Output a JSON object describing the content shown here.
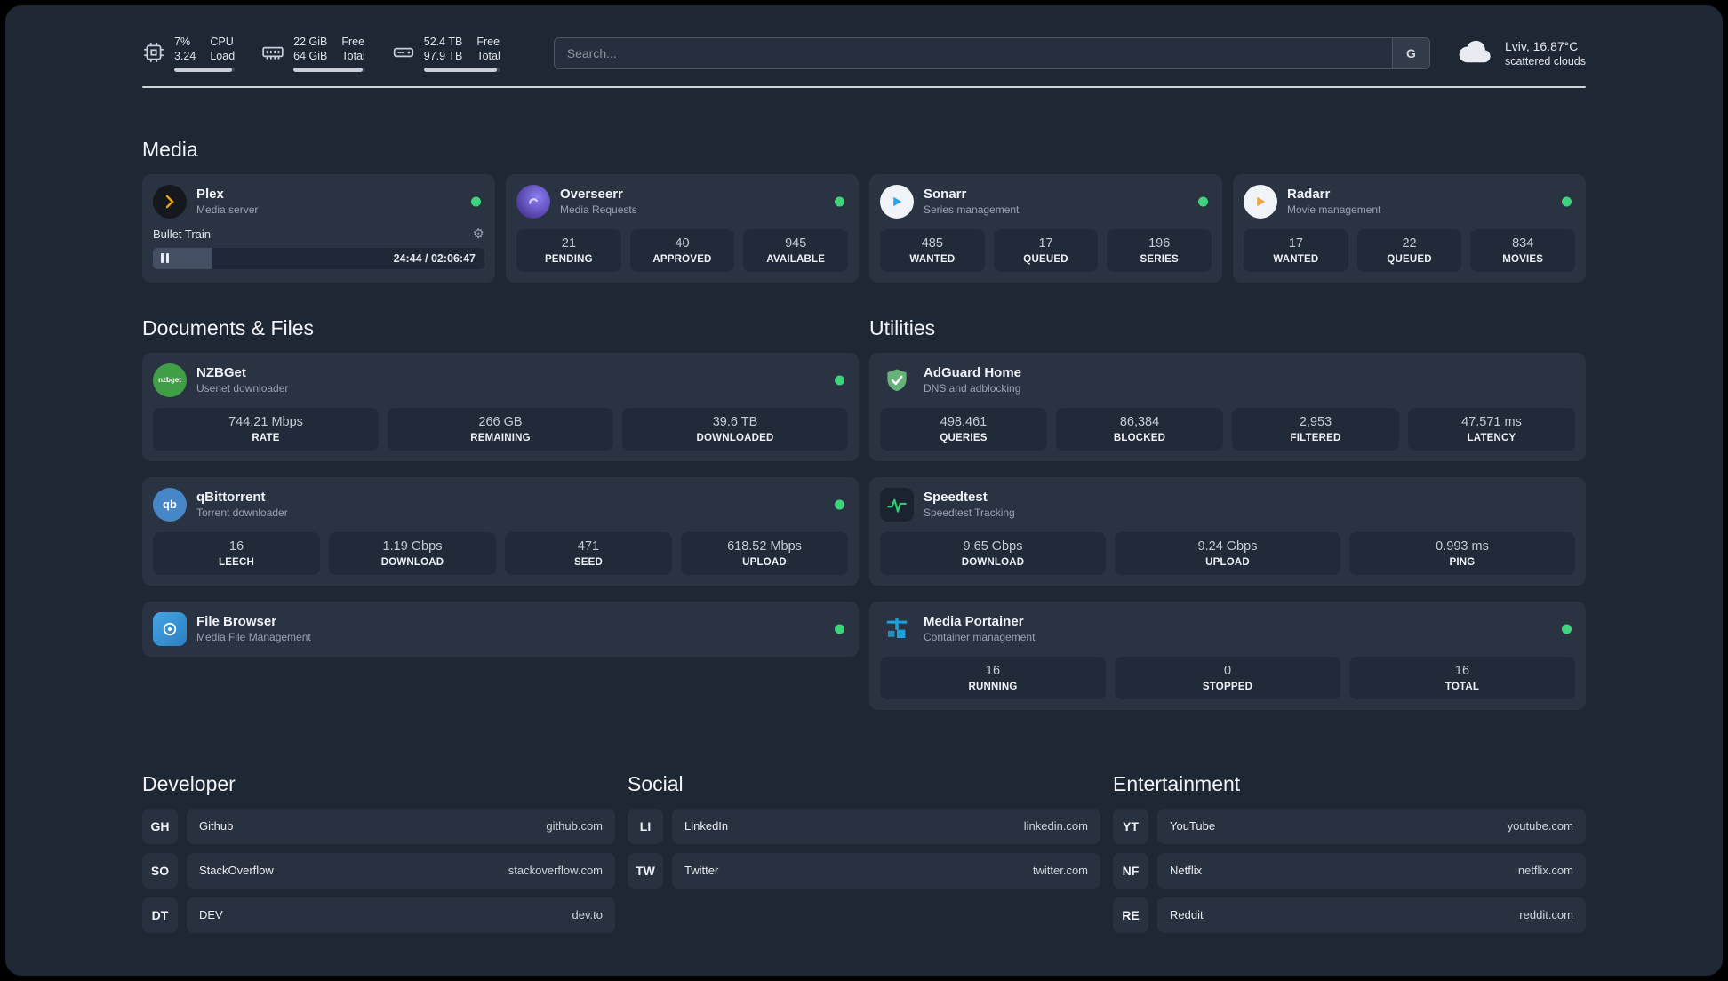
{
  "topbar": {
    "cpu": {
      "percent": "7%",
      "load": "3.24",
      "label_top": "CPU",
      "label_bottom": "Load"
    },
    "ram": {
      "free": "22 GiB",
      "total": "64 GiB",
      "label_top": "Free",
      "label_bottom": "Total"
    },
    "disk": {
      "free": "52.4 TB",
      "total": "97.9 TB",
      "label_top": "Free",
      "label_bottom": "Total"
    },
    "search": {
      "placeholder": "Search...",
      "engine_label": "G"
    },
    "weather": {
      "location": "Lviv, 16.87°C",
      "condition": "scattered clouds"
    }
  },
  "media": {
    "title": "Media",
    "plex": {
      "name": "Plex",
      "subtitle": "Media server",
      "player": {
        "track": "Bullet Train",
        "time": "24:44 / 02:06:47"
      }
    },
    "overseerr": {
      "name": "Overseerr",
      "subtitle": "Media Requests",
      "stats": [
        {
          "value": "21",
          "label": "PENDING"
        },
        {
          "value": "40",
          "label": "APPROVED"
        },
        {
          "value": "945",
          "label": "AVAILABLE"
        }
      ]
    },
    "sonarr": {
      "name": "Sonarr",
      "subtitle": "Series management",
      "stats": [
        {
          "value": "485",
          "label": "WANTED"
        },
        {
          "value": "17",
          "label": "QUEUED"
        },
        {
          "value": "196",
          "label": "SERIES"
        }
      ]
    },
    "radarr": {
      "name": "Radarr",
      "subtitle": "Movie management",
      "stats": [
        {
          "value": "17",
          "label": "WANTED"
        },
        {
          "value": "22",
          "label": "QUEUED"
        },
        {
          "value": "834",
          "label": "MOVIES"
        }
      ]
    }
  },
  "documents": {
    "title": "Documents & Files",
    "nzbget": {
      "name": "NZBGet",
      "subtitle": "Usenet downloader",
      "icon_text": "nzbget",
      "stats": [
        {
          "value": "744.21 Mbps",
          "label": "RATE"
        },
        {
          "value": "266 GB",
          "label": "REMAINING"
        },
        {
          "value": "39.6 TB",
          "label": "DOWNLOADED"
        }
      ]
    },
    "qbittorrent": {
      "name": "qBittorrent",
      "subtitle": "Torrent downloader",
      "icon_text": "qb",
      "stats": [
        {
          "value": "16",
          "label": "LEECH"
        },
        {
          "value": "1.19 Gbps",
          "label": "DOWNLOAD"
        },
        {
          "value": "471",
          "label": "SEED"
        },
        {
          "value": "618.52 Mbps",
          "label": "UPLOAD"
        }
      ]
    },
    "filebrowser": {
      "name": "File Browser",
      "subtitle": "Media File Management"
    }
  },
  "utilities": {
    "title": "Utilities",
    "adguard": {
      "name": "AdGuard Home",
      "subtitle": "DNS and adblocking",
      "stats": [
        {
          "value": "498,461",
          "label": "QUERIES"
        },
        {
          "value": "86,384",
          "label": "BLOCKED"
        },
        {
          "value": "2,953",
          "label": "FILTERED"
        },
        {
          "value": "47.571 ms",
          "label": "LATENCY"
        }
      ]
    },
    "speedtest": {
      "name": "Speedtest",
      "subtitle": "Speedtest Tracking",
      "stats": [
        {
          "value": "9.65 Gbps",
          "label": "DOWNLOAD"
        },
        {
          "value": "9.24 Gbps",
          "label": "UPLOAD"
        },
        {
          "value": "0.993 ms",
          "label": "PING"
        }
      ]
    },
    "portainer": {
      "name": "Media Portainer",
      "subtitle": "Container management",
      "stats": [
        {
          "value": "16",
          "label": "RUNNING"
        },
        {
          "value": "0",
          "label": "STOPPED"
        },
        {
          "value": "16",
          "label": "TOTAL"
        }
      ]
    }
  },
  "bookmarks": {
    "developer": {
      "title": "Developer",
      "items": [
        {
          "abbr": "GH",
          "name": "Github",
          "url": "github.com"
        },
        {
          "abbr": "SO",
          "name": "StackOverflow",
          "url": "stackoverflow.com"
        },
        {
          "abbr": "DT",
          "name": "DEV",
          "url": "dev.to"
        }
      ]
    },
    "social": {
      "title": "Social",
      "items": [
        {
          "abbr": "LI",
          "name": "LinkedIn",
          "url": "linkedin.com"
        },
        {
          "abbr": "TW",
          "name": "Twitter",
          "url": "twitter.com"
        }
      ]
    },
    "entertainment": {
      "title": "Entertainment",
      "items": [
        {
          "abbr": "YT",
          "name": "YouTube",
          "url": "youtube.com"
        },
        {
          "abbr": "NF",
          "name": "Netflix",
          "url": "netflix.com"
        },
        {
          "abbr": "RE",
          "name": "Reddit",
          "url": "reddit.com"
        }
      ]
    }
  }
}
